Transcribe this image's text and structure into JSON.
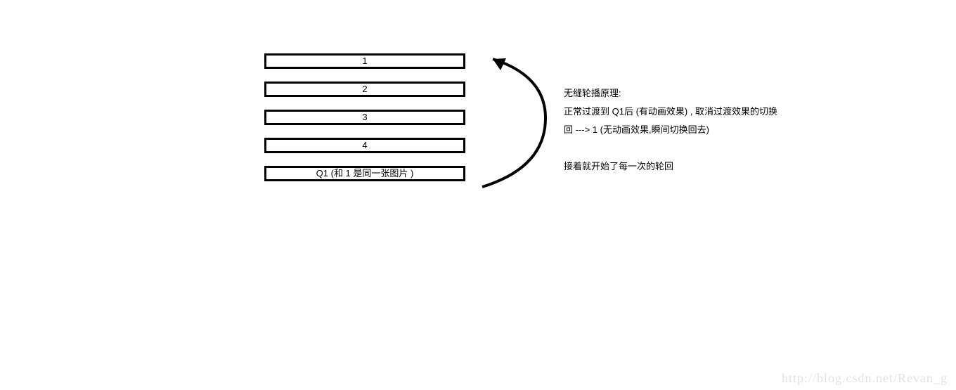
{
  "boxes": {
    "items": [
      {
        "label": "1"
      },
      {
        "label": "2"
      },
      {
        "label": "3"
      },
      {
        "label": "4"
      },
      {
        "label": "Q1 (和 1 是同一张图片 )"
      }
    ]
  },
  "desc": {
    "title": "无缝轮播原理:",
    "line1": "正常过渡到 Q1后 (有动画效果)  , 取消过渡效果的切换",
    "line2": "回 ---> 1  (无动画效果,瞬间切换回去)",
    "line3": "接着就开始了每一次的轮回"
  },
  "watermark": "http://blog.csdn.net/Revan_g"
}
